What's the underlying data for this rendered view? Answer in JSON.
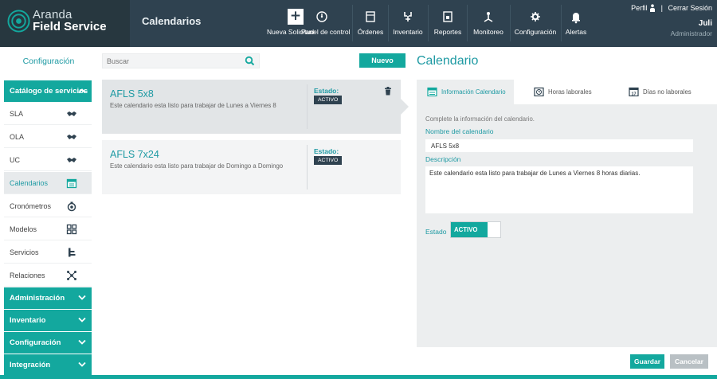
{
  "brand": {
    "name_line1": "Aranda",
    "name_line2": "Field Service"
  },
  "module_title": "Calendarios",
  "nav": [
    {
      "label": "Nueva Solicitud",
      "icon": "plus-icon"
    },
    {
      "label": "Panel de control",
      "icon": "dashboard-icon"
    },
    {
      "label": "Órdenes",
      "icon": "orders-icon"
    },
    {
      "label": "Inventario",
      "icon": "inventory-icon"
    },
    {
      "label": "Reportes",
      "icon": "reports-icon"
    },
    {
      "label": "Monitoreo",
      "icon": "monitor-icon"
    },
    {
      "label": "Configuración",
      "icon": "gear-icon"
    },
    {
      "label": "Alertas",
      "icon": "bell-icon"
    }
  ],
  "profile": {
    "perfil": "Perfil",
    "separator": "|",
    "logout": "Cerrar Sesión",
    "user_name": "Juli",
    "user_role": "Administrador"
  },
  "sidebar": {
    "title": "Configuración",
    "groups": [
      {
        "label": "Catálogo de servicios",
        "expanded": true
      },
      {
        "label": "Administración",
        "expanded": false
      },
      {
        "label": "Inventario",
        "expanded": false
      },
      {
        "label": "Configuración",
        "expanded": false
      },
      {
        "label": "Integración",
        "expanded": false
      }
    ],
    "items": [
      {
        "label": "SLA",
        "icon": "handshake-icon"
      },
      {
        "label": "OLA",
        "icon": "handshake-icon"
      },
      {
        "label": "UC",
        "icon": "handshake-icon"
      },
      {
        "label": "Calendarios",
        "icon": "calendar-icon",
        "active": true
      },
      {
        "label": "Cronómetros",
        "icon": "stopwatch-icon"
      },
      {
        "label": "Modelos",
        "icon": "models-icon"
      },
      {
        "label": "Servicios",
        "icon": "services-icon"
      },
      {
        "label": "Relaciones",
        "icon": "relations-icon"
      }
    ]
  },
  "search": {
    "placeholder": "Buscar"
  },
  "new_button": "Nuevo",
  "calendars": [
    {
      "title": "AFLS 5x8",
      "description": "Este calendario esta listo para trabajar de Lunes a Viernes 8",
      "state_label": "Estado:",
      "state": "ACTIVO",
      "selected": true
    },
    {
      "title": "AFLS 7x24",
      "description": "Este calendario esta listo para trabajar de Domingo a Domingo",
      "state_label": "Estado:",
      "state": "ACTIVO",
      "selected": false
    }
  ],
  "detail": {
    "title": "Calendario",
    "tabs": [
      {
        "label": "Información Calendario",
        "active": true,
        "icon": "calendar-icon"
      },
      {
        "label": "Horas laborales",
        "active": false,
        "icon": "clock-icon"
      },
      {
        "label": "Días no laborales",
        "active": false,
        "icon": "calendar-17-icon"
      }
    ],
    "hint": "Complete la información del calendario.",
    "name_label": "Nombre del calendario",
    "name_value": "AFLS 5x8",
    "description_label": "Descripción",
    "description_value": "Este calendario esta listo para trabajar de Lunes a Viernes 8 horas diarias.",
    "state_label": "Estado",
    "state_value": "ACTIVO"
  },
  "actions": {
    "save": "Guardar",
    "cancel": "Cancelar"
  },
  "colors": {
    "header": "#2f4250",
    "accent": "#13a89e",
    "text_accent": "#1e9aa3",
    "panel": "#eceeef"
  }
}
